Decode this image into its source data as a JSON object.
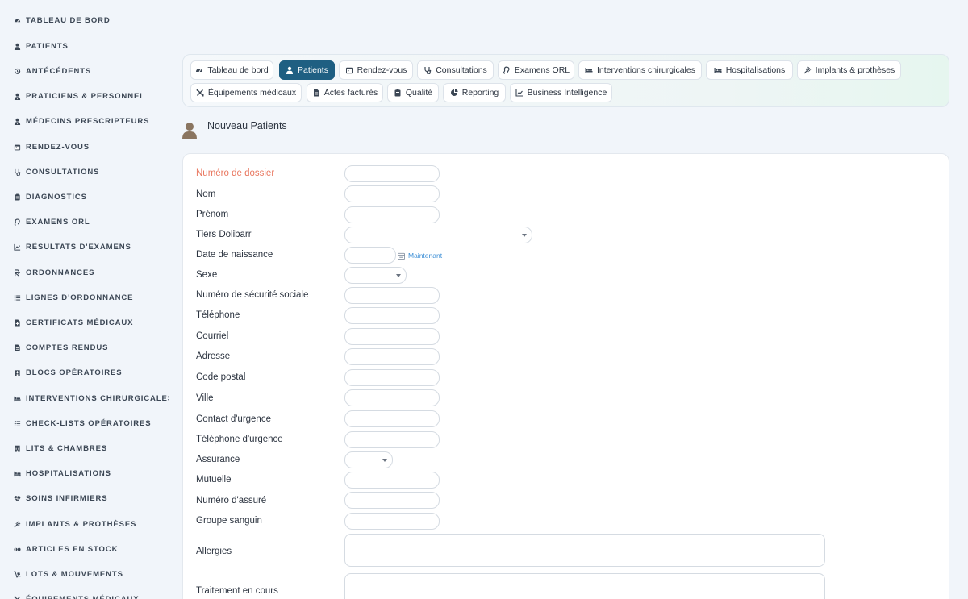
{
  "sidebar": {
    "items": [
      {
        "label": "TABLEAU DE BORD",
        "icon": "dashboard-icon"
      },
      {
        "label": "PATIENTS",
        "icon": "user-icon"
      },
      {
        "label": "ANTÉCÉDENTS",
        "icon": "history-icon"
      },
      {
        "label": "PRATICIENS & PERSONNEL",
        "icon": "user-md-icon"
      },
      {
        "label": "MÉDECINS PRESCRIPTEURS",
        "icon": "user-md-icon"
      },
      {
        "label": "RENDEZ-VOUS",
        "icon": "calendar-icon"
      },
      {
        "label": "CONSULTATIONS",
        "icon": "stethoscope-icon"
      },
      {
        "label": "DIAGNOSTICS",
        "icon": "clipboard-icon"
      },
      {
        "label": "EXAMENS ORL",
        "icon": "ear-icon"
      },
      {
        "label": "RÉSULTATS D'EXAMENS",
        "icon": "chart-line-icon"
      },
      {
        "label": "ORDONNANCES",
        "icon": "prescription-icon"
      },
      {
        "label": "LIGNES D'ORDONNANCE",
        "icon": "list-icon"
      },
      {
        "label": "CERTIFICATS MÉDICAUX",
        "icon": "file-medical-icon"
      },
      {
        "label": "COMPTES RENDUS",
        "icon": "file-icon"
      },
      {
        "label": "BLOCS OPÉRATOIRES",
        "icon": "hospital-icon"
      },
      {
        "label": "INTERVENTIONS CHIRURGICALES",
        "icon": "procedures-icon"
      },
      {
        "label": "CHECK-LISTS OPÉRATOIRES",
        "icon": "checklist-icon"
      },
      {
        "label": "LITS & CHAMBRES",
        "icon": "building-icon"
      },
      {
        "label": "HOSPITALISATIONS",
        "icon": "bed-icon"
      },
      {
        "label": "SOINS INFIRMIERS",
        "icon": "heart-icon"
      },
      {
        "label": "IMPLANTS & PROTHÈSES",
        "icon": "implant-icon"
      },
      {
        "label": "ARTICLES EN STOCK",
        "icon": "pills-icon"
      },
      {
        "label": "LOTS & MOUVEMENTS",
        "icon": "dolly-icon"
      },
      {
        "label": "ÉQUIPEMENTS MÉDICAUX",
        "icon": "tools-icon"
      }
    ]
  },
  "tabs": [
    {
      "label": "Tableau de bord",
      "icon": "dashboard-icon",
      "active": false
    },
    {
      "label": "Patients",
      "icon": "user-icon",
      "active": true
    },
    {
      "label": "Rendez-vous",
      "icon": "calendar-icon",
      "active": false
    },
    {
      "label": "Consultations",
      "icon": "stethoscope-icon",
      "active": false
    },
    {
      "label": "Examens ORL",
      "icon": "ear-icon",
      "active": false
    },
    {
      "label": "Interventions chirurgicales",
      "icon": "procedures-icon",
      "active": false
    },
    {
      "label": "Hospitalisations",
      "icon": "bed-icon",
      "active": false
    },
    {
      "label": "Implants & prothèses",
      "icon": "implant-icon",
      "active": false
    },
    {
      "label": "Équipements médicaux",
      "icon": "tools-icon",
      "active": false
    },
    {
      "label": "Actes facturés",
      "icon": "file-icon",
      "active": false
    },
    {
      "label": "Qualité",
      "icon": "clipboard-icon",
      "active": false
    },
    {
      "label": "Reporting",
      "icon": "chart-pie-icon",
      "active": false
    },
    {
      "label": "Business Intelligence",
      "icon": "chart-line-icon",
      "active": false
    }
  ],
  "page": {
    "title": "Nouveau Patients"
  },
  "form": {
    "fields": [
      {
        "label": "Numéro de dossier",
        "required": true,
        "type": "text",
        "value": ""
      },
      {
        "label": "Nom",
        "type": "text",
        "value": ""
      },
      {
        "label": "Prénom",
        "type": "text",
        "value": ""
      },
      {
        "label": "Tiers Dolibarr",
        "type": "select",
        "value": ""
      },
      {
        "label": "Date de naissance",
        "type": "date",
        "value": ""
      },
      {
        "label": "Sexe",
        "type": "select",
        "value": ""
      },
      {
        "label": "Numéro de sécurité sociale",
        "type": "text",
        "value": ""
      },
      {
        "label": "Téléphone",
        "type": "text",
        "value": ""
      },
      {
        "label": "Courriel",
        "type": "text",
        "value": ""
      },
      {
        "label": "Adresse",
        "type": "text",
        "value": ""
      },
      {
        "label": "Code postal",
        "type": "text",
        "value": ""
      },
      {
        "label": "Ville",
        "type": "text",
        "value": ""
      },
      {
        "label": "Contact d'urgence",
        "type": "text",
        "value": ""
      },
      {
        "label": "Téléphone d'urgence",
        "type": "text",
        "value": ""
      },
      {
        "label": "Assurance",
        "type": "select",
        "value": ""
      },
      {
        "label": "Mutuelle",
        "type": "text",
        "value": ""
      },
      {
        "label": "Numéro d'assuré",
        "type": "text",
        "value": ""
      },
      {
        "label": "Groupe sanguin",
        "type": "text",
        "value": ""
      },
      {
        "label": "Allergies",
        "type": "textarea",
        "value": ""
      },
      {
        "label": "Traitement en cours",
        "type": "textarea",
        "value": ""
      }
    ],
    "now_link": "Maintenant"
  },
  "colors": {
    "accent": "#1f5f82",
    "required_label": "#e9775f",
    "link": "#3d8fd6",
    "background": "#f1f5fa"
  }
}
